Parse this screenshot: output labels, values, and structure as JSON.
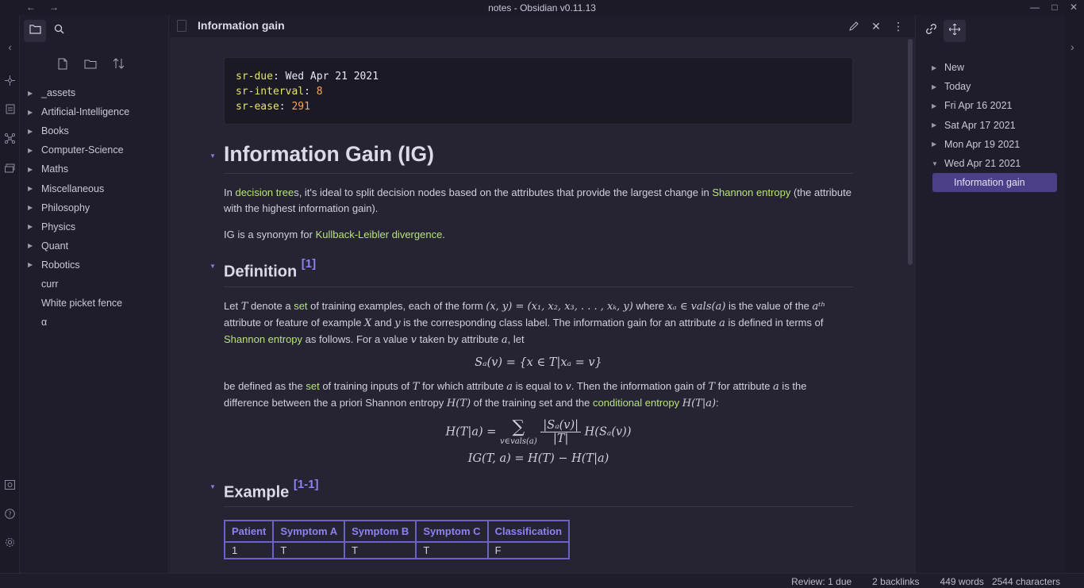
{
  "window": {
    "title": "notes - Obsidian v0.11.13"
  },
  "left_pane": {
    "tabs": [
      "folder-icon",
      "search-icon"
    ],
    "actions": [
      "new-note-icon",
      "new-folder-icon",
      "sort-icon"
    ],
    "items": [
      {
        "label": "_assets",
        "folder": true
      },
      {
        "label": "Artificial-Intelligence",
        "folder": true
      },
      {
        "label": "Books",
        "folder": true
      },
      {
        "label": "Computer-Science",
        "folder": true
      },
      {
        "label": "Maths",
        "folder": true
      },
      {
        "label": "Miscellaneous",
        "folder": true
      },
      {
        "label": "Philosophy",
        "folder": true
      },
      {
        "label": "Physics",
        "folder": true
      },
      {
        "label": "Quant",
        "folder": true
      },
      {
        "label": "Robotics",
        "folder": true
      },
      {
        "label": "curr",
        "folder": false
      },
      {
        "label": "White picket fence",
        "folder": false
      },
      {
        "label": "α",
        "folder": false
      }
    ]
  },
  "editor": {
    "tab_title": "Information gain",
    "frontmatter": {
      "due_key": "sr-due",
      "due_value": "Wed Apr 21 2021",
      "interval_key": "sr-interval",
      "interval_value": "8",
      "ease_key": "sr-ease",
      "ease_value": "291"
    },
    "h1": "Information Gain (IG)",
    "intro": {
      "p1_a": "In ",
      "p1_link1": "decision tree",
      "p1_b": "s, it's ideal to split decision nodes based on the attributes that provide the largest change in ",
      "p1_link2": "Shannon entropy",
      "p1_c": " (the attribute with the highest information gain).",
      "p2_a": "IG is a synonym for ",
      "p2_link": "Kullback-Leibler divergence",
      "p2_b": "."
    },
    "definition": {
      "heading": "Definition",
      "ref": "[1]",
      "p1_a": "Let ",
      "p1_T": "T",
      "p1_b": " denote a ",
      "p1_link_set": "set",
      "p1_c": " of training examples, each of the form ",
      "p1_form": "(x, y) = (x₁, x₂, x₃, . . . , xₖ, y)",
      "p1_d": " where ",
      "p1_xa": "xₐ ∈ vals(a)",
      "p1_e": " is the value of the ",
      "p1_ath": "aᵗʰ",
      "p1_f": " attribute or feature of example ",
      "p1_X": "X",
      "p1_g": " and ",
      "p1_y": "y",
      "p1_h": " is the corresponding class label. The information gain for an attribute ",
      "p1_a_var": "a",
      "p1_i": " is defined in terms of ",
      "p1_link_shannon": "Shannon entropy",
      "p1_j": " as follows. For a value ",
      "p1_v": "v",
      "p1_k": " taken by attribute ",
      "p1_a2": "a",
      "p1_l": ", let",
      "eq1": "Sₐ(v) = {x ∈ T|xₐ = v}",
      "p2_a": "be defined as the ",
      "p2_link_set": "set",
      "p2_b": " of training inputs of ",
      "p2_T": "T",
      "p2_c": " for which attribute ",
      "p2_a_var": "a",
      "p2_d": " is equal to ",
      "p2_v": "v",
      "p2_e": ". Then the information gain of ",
      "p2_T2": "T",
      "p2_f": " for attribute ",
      "p2_a2": "a",
      "p2_g": " is the difference between the a priori Shannon entropy ",
      "p2_HT": "H(T)",
      "p2_h": " of the training set and the ",
      "p2_link_cond": "conditional entropy",
      "p2_HTa": "H(T|a)",
      "p2_i": ":",
      "eq2_lhs": "H(T|a) = ",
      "eq2_sum": "∑",
      "eq2_sub": "v∈vals(a)",
      "eq2_num": "|Sₐ(v)|",
      "eq2_den": "|T|",
      "eq2_rhs": "H(Sₐ(v))",
      "eq3": "IG(T, a) = H(T) − H(T|a)"
    },
    "example": {
      "heading": "Example",
      "ref": "[1-1]",
      "columns": [
        "Patient",
        "Symptom A",
        "Symptom B",
        "Symptom C",
        "Classification"
      ],
      "rows": [
        [
          "1",
          "T",
          "T",
          "T",
          "F"
        ]
      ]
    }
  },
  "right_pane": {
    "tabs": [
      "link-icon",
      "graph-icon"
    ],
    "items": [
      {
        "label": "New",
        "expanded": false
      },
      {
        "label": "Today",
        "expanded": false
      },
      {
        "label": "Fri Apr 16 2021",
        "expanded": false
      },
      {
        "label": "Sat Apr 17 2021",
        "expanded": false
      },
      {
        "label": "Mon Apr 19 2021",
        "expanded": false
      },
      {
        "label": "Wed Apr 21 2021",
        "expanded": true
      }
    ],
    "selected_child": "Information gain"
  },
  "status": {
    "review": "Review: 1 due",
    "backlinks": "2 backlinks",
    "words": "449 words",
    "characters": "2544 characters"
  }
}
